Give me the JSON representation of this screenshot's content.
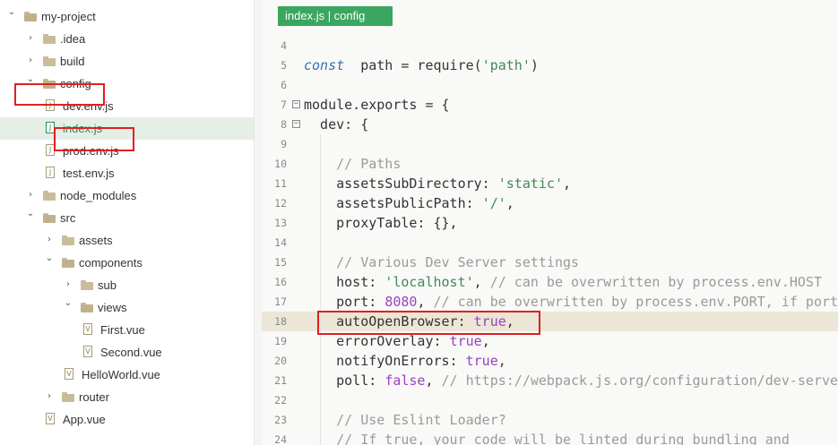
{
  "sidebar": {
    "items": [
      {
        "label": "my-project",
        "type": "folder",
        "expanded": true,
        "depth": 0
      },
      {
        "label": ".idea",
        "type": "folder",
        "expanded": false,
        "depth": 1
      },
      {
        "label": "build",
        "type": "folder",
        "expanded": false,
        "depth": 1
      },
      {
        "label": "config",
        "type": "folder",
        "expanded": true,
        "depth": 1
      },
      {
        "label": "dev.env.js",
        "type": "file",
        "depth": 2
      },
      {
        "label": "index.js",
        "type": "file",
        "depth": 2,
        "selected": true
      },
      {
        "label": "prod.env.js",
        "type": "file",
        "depth": 2
      },
      {
        "label": "test.env.js",
        "type": "file",
        "depth": 2
      },
      {
        "label": "node_modules",
        "type": "folder",
        "expanded": false,
        "depth": 1
      },
      {
        "label": "src",
        "type": "folder",
        "expanded": true,
        "depth": 1
      },
      {
        "label": "assets",
        "type": "folder",
        "expanded": false,
        "depth": 2
      },
      {
        "label": "components",
        "type": "folder",
        "expanded": true,
        "depth": 2
      },
      {
        "label": "sub",
        "type": "folder",
        "expanded": false,
        "depth": 3
      },
      {
        "label": "views",
        "type": "folder",
        "expanded": true,
        "depth": 3
      },
      {
        "label": "First.vue",
        "type": "file",
        "depth": 4
      },
      {
        "label": "Second.vue",
        "type": "file",
        "depth": 4
      },
      {
        "label": "HelloWorld.vue",
        "type": "file",
        "depth": 3
      },
      {
        "label": "router",
        "type": "folder",
        "expanded": false,
        "depth": 2
      },
      {
        "label": "App.vue",
        "type": "file",
        "depth": 2
      }
    ]
  },
  "editor": {
    "tab_label": "index.js | config",
    "lines": [
      {
        "no": "4",
        "tokens": []
      },
      {
        "no": "5",
        "tokens": [
          [
            "kw",
            "const"
          ],
          [
            "",
            "  path = require("
          ],
          [
            "str",
            "'path'"
          ],
          [
            "",
            ")"
          ]
        ]
      },
      {
        "no": "6",
        "tokens": []
      },
      {
        "no": "7",
        "fold": true,
        "tokens": [
          [
            "",
            "module.exports = {"
          ]
        ]
      },
      {
        "no": "8",
        "fold": true,
        "tokens": [
          [
            "",
            "  dev: {"
          ]
        ]
      },
      {
        "no": "9",
        "tokens": []
      },
      {
        "no": "10",
        "tokens": [
          [
            "cmt",
            "    // Paths"
          ]
        ]
      },
      {
        "no": "11",
        "tokens": [
          [
            "",
            "    assetsSubDirectory: "
          ],
          [
            "str",
            "'static'"
          ],
          [
            "",
            ","
          ]
        ]
      },
      {
        "no": "12",
        "tokens": [
          [
            "",
            "    assetsPublicPath: "
          ],
          [
            "str",
            "'/'"
          ],
          [
            "",
            ","
          ]
        ]
      },
      {
        "no": "13",
        "tokens": [
          [
            "",
            "    proxyTable: {},"
          ]
        ]
      },
      {
        "no": "14",
        "tokens": []
      },
      {
        "no": "15",
        "tokens": [
          [
            "cmt",
            "    // Various Dev Server settings"
          ]
        ]
      },
      {
        "no": "16",
        "tokens": [
          [
            "",
            "    host: "
          ],
          [
            "str",
            "'localhost'"
          ],
          [
            "",
            ", "
          ],
          [
            "cmt",
            "// can be overwritten by process.env.HOST"
          ]
        ]
      },
      {
        "no": "17",
        "tokens": [
          [
            "",
            "    port: "
          ],
          [
            "num",
            "8080"
          ],
          [
            "",
            ", "
          ],
          [
            "cmt",
            "// can be overwritten by process.env.PORT, if port"
          ]
        ]
      },
      {
        "no": "18",
        "highlight": true,
        "tokens": [
          [
            "",
            "    autoOpenBrowser: "
          ],
          [
            "bool",
            "true"
          ],
          [
            "",
            ","
          ]
        ]
      },
      {
        "no": "19",
        "tokens": [
          [
            "",
            "    errorOverlay: "
          ],
          [
            "bool",
            "true"
          ],
          [
            "",
            ","
          ]
        ]
      },
      {
        "no": "20",
        "tokens": [
          [
            "",
            "    notifyOnErrors: "
          ],
          [
            "bool",
            "true"
          ],
          [
            "",
            ","
          ]
        ]
      },
      {
        "no": "21",
        "tokens": [
          [
            "",
            "    poll: "
          ],
          [
            "bool",
            "false"
          ],
          [
            "",
            ", "
          ],
          [
            "cmt",
            "// https://webpack.js.org/configuration/dev-serve"
          ]
        ]
      },
      {
        "no": "22",
        "tokens": []
      },
      {
        "no": "23",
        "tokens": [
          [
            "cmt",
            "    // Use Eslint Loader?"
          ]
        ]
      },
      {
        "no": "24",
        "tokens": [
          [
            "cmt",
            "    // If true, your code will be linted during bundling and"
          ]
        ]
      }
    ]
  },
  "colors": {
    "accent": "#3aa660",
    "annotation": "#e02020",
    "selected_row": "#e6efe6",
    "highlight_line": "#ebe6d6"
  }
}
